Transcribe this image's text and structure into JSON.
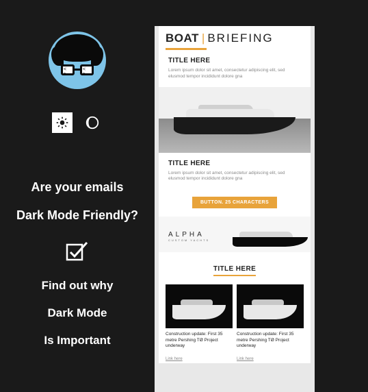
{
  "left": {
    "headline_line1": "Are your emails",
    "headline_line2": "Dark Mode Friendly?",
    "sub_line1": "Find out why",
    "sub_line2": "Dark Mode",
    "sub_line3": "Is Important"
  },
  "preview": {
    "brand_strong": "BOAT",
    "brand_light": "BRIEFING",
    "article1": {
      "title": "TITLE HERE",
      "body": "Lorem ipsum dolor sit amet, consectetur adipiscing elit, sed elusmod tempor incididunt dolore gna"
    },
    "article2": {
      "title": "TITLE HERE",
      "body": "Lorem ipsum dolor sit amet, consectetur adipiscing elit, sed elusmod tempor incididunt dolore gna",
      "button": "BUTTON. 25 CHARACTERS"
    },
    "alpha_label": "ALPHA",
    "alpha_sub": "CUSTOM YACHTS",
    "section_title": "TITLE HERE",
    "cards": [
      {
        "title": "Construction update: First 35 metre Pershing TØ Project underway",
        "link": "Link here"
      },
      {
        "title": "Construction update: First 35 metre Pershing TØ Project underway",
        "link": "Link here"
      }
    ]
  }
}
